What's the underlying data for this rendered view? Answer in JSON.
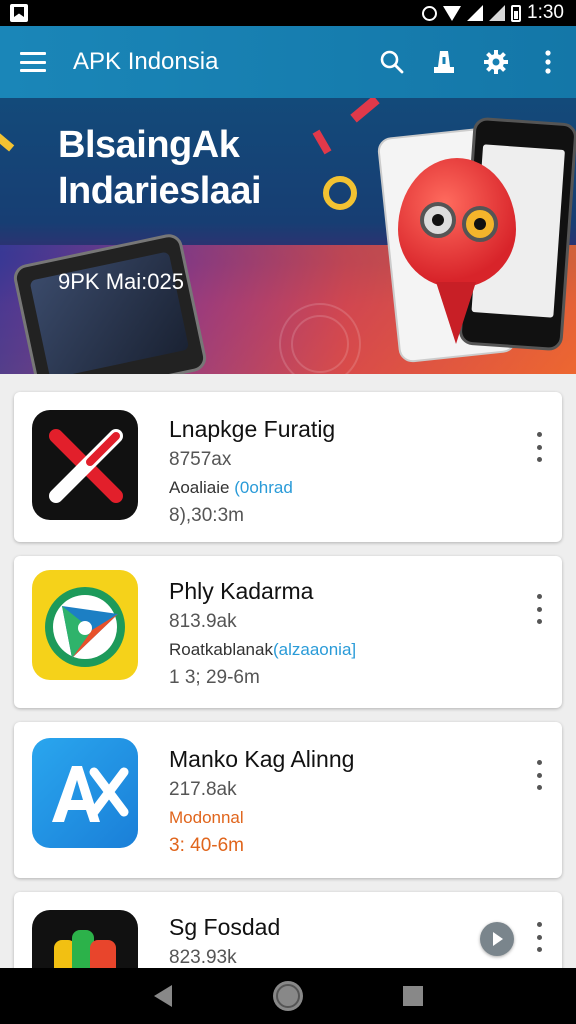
{
  "status_bar": {
    "time": "1:30"
  },
  "app_bar": {
    "title": "APK Indonsia"
  },
  "banner": {
    "title_line1": "BlsaingAk",
    "title_line2": "Indarieslaai",
    "subtitle": "9PK Mai:025"
  },
  "apps": [
    {
      "name": "Lnapkge Furatig",
      "size": "8757ax",
      "status_prefix": "Aoaliaie",
      "status_highlight": "(0ohrad",
      "status_color": "#2a9bd8",
      "time": "8),30:3m",
      "icon": "red-x-app-icon"
    },
    {
      "name": "Phly Kadarma",
      "size": "813.9ak",
      "status_prefix": "Roatkablanak",
      "status_highlight": "(alzaaonia]",
      "status_color": "#2a9bd8",
      "time": "1 3; 29-6m",
      "icon": "yellow-play-app-icon"
    },
    {
      "name": "Manko Kag Alinng",
      "size": "217.8ak",
      "status_prefix": "Modonnal",
      "status_highlight": "",
      "status_color": "#e0651c",
      "time": "3: 40-6m",
      "icon": "blue-translate-app-icon"
    },
    {
      "name": "Sg Fosdad",
      "size": "823.93k",
      "status_prefix": "",
      "status_highlight": "",
      "status_color": "#333",
      "time": "",
      "icon": "multicolor-app-icon"
    }
  ],
  "colors": {
    "app_bar": "#1a86b8",
    "accent_blue": "#2a9bd8",
    "accent_orange": "#e0651c"
  }
}
